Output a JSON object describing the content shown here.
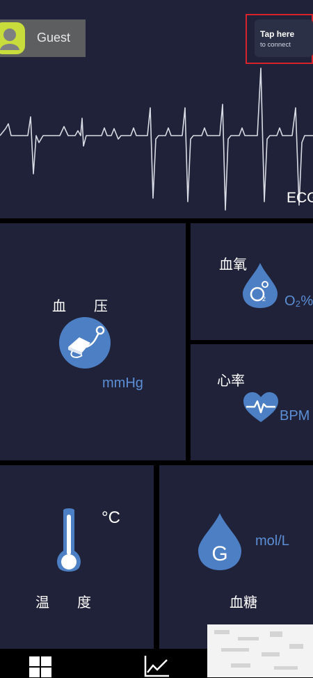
{
  "header": {
    "user_name": "Guest",
    "connect_main": "Tap here",
    "connect_sub": "to connect",
    "ecg_label": "ECG"
  },
  "tiles": {
    "blood_pressure": {
      "label": "血　　压",
      "unit": "mmHg",
      "icon": "blood-pressure-cuff-icon"
    },
    "spo2": {
      "label": "血氧",
      "unit": "O₂%",
      "icon": "oxygen-drop-icon"
    },
    "heart_rate": {
      "label": "心率",
      "unit": "BPM",
      "icon": "heart-pulse-icon"
    },
    "temperature": {
      "label": "温　　度",
      "unit": "°C",
      "icon": "thermometer-icon"
    },
    "glucose": {
      "label": "血糖",
      "unit": "mol/L",
      "icon": "glucose-drop-icon"
    }
  },
  "nav": {
    "items": [
      {
        "name": "home",
        "icon": "grid-icon"
      },
      {
        "name": "trend",
        "icon": "line-chart-icon"
      }
    ]
  },
  "colors": {
    "tile_bg": "#1f2238",
    "accent": "#4d7fc4",
    "unit_text": "#5c8fd6",
    "highlight_border": "#d6232c",
    "avatar": "#c8dc3c"
  }
}
